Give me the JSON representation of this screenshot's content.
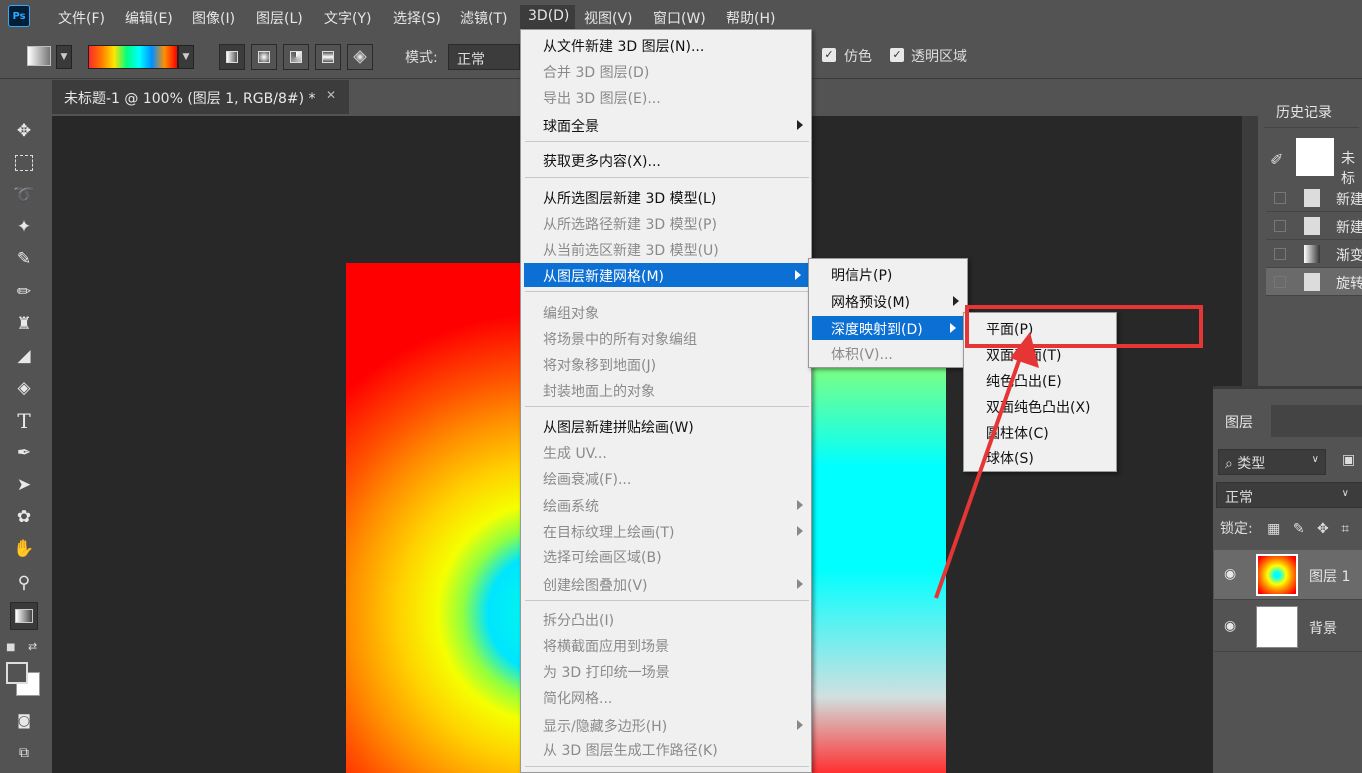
{
  "app": {
    "logo": "Ps"
  },
  "menubar": {
    "items": [
      "文件(F)",
      "编辑(E)",
      "图像(I)",
      "图层(L)",
      "文字(Y)",
      "选择(S)",
      "滤镜(T)",
      "3D(D)",
      "视图(V)",
      "窗口(W)",
      "帮助(H)"
    ]
  },
  "options": {
    "mode_label": "模式:",
    "mode_value": "正常",
    "dither_label": "仿色",
    "transparency_label": "透明区域"
  },
  "document_tab": {
    "title": "未标题-1 @ 100% (图层 1, RGB/8#) *",
    "close": "✕"
  },
  "menu_3d": {
    "items": [
      {
        "label": "从文件新建 3D 图层(N)...",
        "disabled": false
      },
      {
        "label": "合并 3D 图层(D)",
        "disabled": true
      },
      {
        "label": "导出 3D 图层(E)...",
        "disabled": true
      },
      {
        "label": "球面全景",
        "disabled": false,
        "submenu": true
      },
      {
        "label": "获取更多内容(X)...",
        "disabled": false
      },
      {
        "label": "从所选图层新建 3D 模型(L)",
        "disabled": false
      },
      {
        "label": "从所选路径新建 3D 模型(P)",
        "disabled": true
      },
      {
        "label": "从当前选区新建 3D 模型(U)",
        "disabled": true
      },
      {
        "label": "从图层新建网格(M)",
        "disabled": false,
        "submenu": true,
        "highlighted": true
      },
      {
        "label": "编组对象",
        "disabled": true
      },
      {
        "label": "将场景中的所有对象编组",
        "disabled": true
      },
      {
        "label": "将对象移到地面(J)",
        "disabled": true
      },
      {
        "label": "封装地面上的对象",
        "disabled": true
      },
      {
        "label": "从图层新建拼贴绘画(W)",
        "disabled": false
      },
      {
        "label": "生成 UV...",
        "disabled": true
      },
      {
        "label": "绘画衰减(F)...",
        "disabled": true
      },
      {
        "label": "绘画系统",
        "disabled": true,
        "submenu": true
      },
      {
        "label": "在目标纹理上绘画(T)",
        "disabled": true,
        "submenu": true
      },
      {
        "label": "选择可绘画区域(B)",
        "disabled": true
      },
      {
        "label": "创建绘图叠加(V)",
        "disabled": true,
        "submenu": true
      },
      {
        "label": "拆分凸出(I)",
        "disabled": true
      },
      {
        "label": "将横截面应用到场景",
        "disabled": true
      },
      {
        "label": "为 3D 打印统一场景",
        "disabled": true
      },
      {
        "label": "简化网格...",
        "disabled": true
      },
      {
        "label": "显示/隐藏多边形(H)",
        "disabled": true,
        "submenu": true
      },
      {
        "label": "从 3D 图层生成工作路径(K)",
        "disabled": true
      }
    ]
  },
  "submenu_mesh": {
    "items": [
      {
        "label": "明信片(P)",
        "disabled": false
      },
      {
        "label": "网格预设(M)",
        "disabled": false,
        "submenu": true
      },
      {
        "label": "深度映射到(D)",
        "disabled": false,
        "submenu": true,
        "highlighted": true
      },
      {
        "label": "体积(V)...",
        "disabled": true
      }
    ]
  },
  "submenu_depth": {
    "items": [
      "平面(P)",
      "双面平面(T)",
      "纯色凸出(E)",
      "双面纯色凸出(X)",
      "圆柱体(C)",
      "球体(S)"
    ]
  },
  "history": {
    "tab": "历史记录",
    "snapshot_label": "未标",
    "items": [
      "新建",
      "新建",
      "渐变",
      "旋转"
    ]
  },
  "layers": {
    "tab": "图层",
    "filter_label": "类型",
    "blend_mode": "正常",
    "lock_label": "锁定:",
    "items": [
      {
        "name": "图层 1",
        "selected": true
      },
      {
        "name": "背景",
        "selected": false
      }
    ]
  },
  "colors": {
    "accent": "#0c6fd4",
    "annotation_red": "#e63535"
  }
}
